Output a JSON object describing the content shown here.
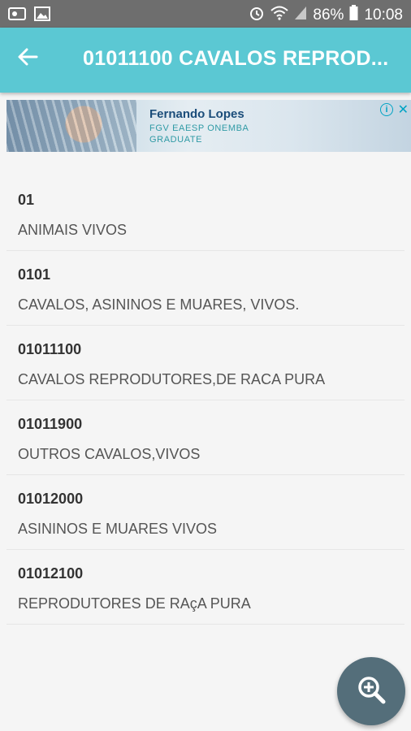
{
  "status_bar": {
    "battery": "86%",
    "time": "10:08",
    "icons": [
      "gallery-icon",
      "image-icon",
      "alarm-icon",
      "wifi-icon",
      "signal-icon",
      "battery-icon"
    ]
  },
  "app_bar": {
    "title": "01011100 CAVALOS REPROD...",
    "back_icon": "arrow-back-icon",
    "color": "#5bc8d3"
  },
  "ad": {
    "name": "Fernando Lopes",
    "line1": "FGV EAESP ONEMBA",
    "line2": "GRADUATE",
    "info_icon": "info-icon",
    "close_icon": "close-icon"
  },
  "list": [
    {
      "code": "01",
      "description": "ANIMAIS VIVOS"
    },
    {
      "code": "0101",
      "description": "CAVALOS, ASININOS E MUARES, VIVOS."
    },
    {
      "code": "01011100",
      "description": "CAVALOS REPRODUTORES,DE RACA PURA"
    },
    {
      "code": "01011900",
      "description": "OUTROS CAVALOS,VIVOS"
    },
    {
      "code": "01012000",
      "description": "ASININOS E MUARES VIVOS"
    },
    {
      "code": "01012100",
      "description": "REPRODUTORES DE RAçA PURA"
    }
  ],
  "fab": {
    "icon": "zoom-in-icon",
    "color": "#546e7a"
  }
}
